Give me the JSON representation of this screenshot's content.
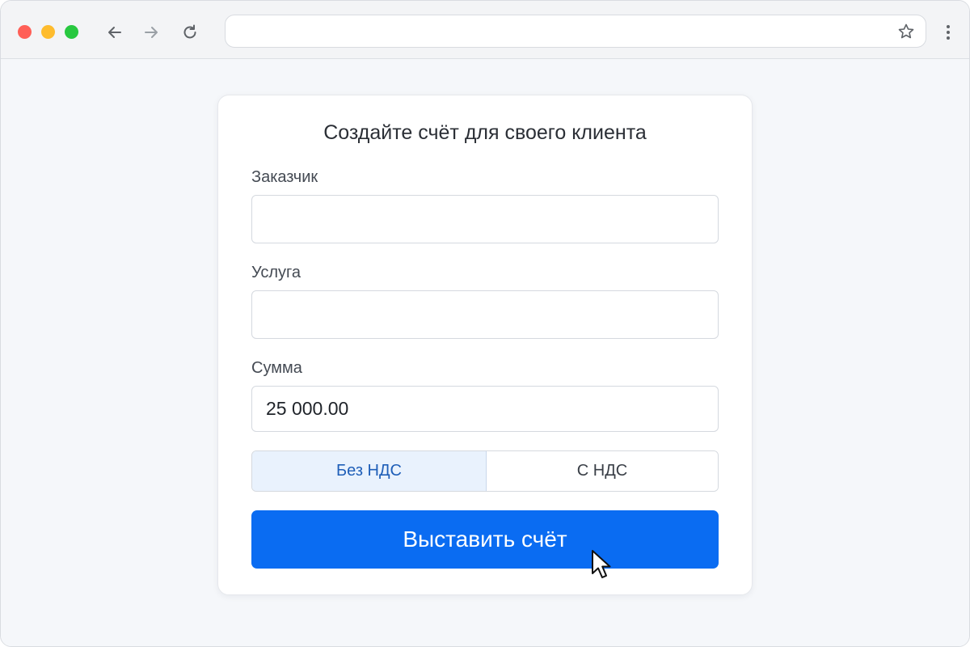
{
  "browser": {
    "address_value": "",
    "icons": {
      "back": "arrow-left-icon",
      "forward": "arrow-right-icon",
      "reload": "reload-icon",
      "bookmark": "star-icon",
      "menu": "kebab-menu-icon"
    }
  },
  "form": {
    "title": "Создайте счёт для своего клиента",
    "customer": {
      "label": "Заказчик",
      "value": ""
    },
    "service": {
      "label": "Услуга",
      "value": ""
    },
    "amount": {
      "label": "Сумма",
      "value": "25 000.00"
    },
    "vat": {
      "options": [
        "Без НДС",
        "С НДС"
      ],
      "selected": "Без НДС"
    },
    "submit_label": "Выставить счёт"
  },
  "colors": {
    "accent": "#0a6cf2",
    "selected_bg": "#e9f2fd",
    "selected_text": "#1f5fb8"
  }
}
